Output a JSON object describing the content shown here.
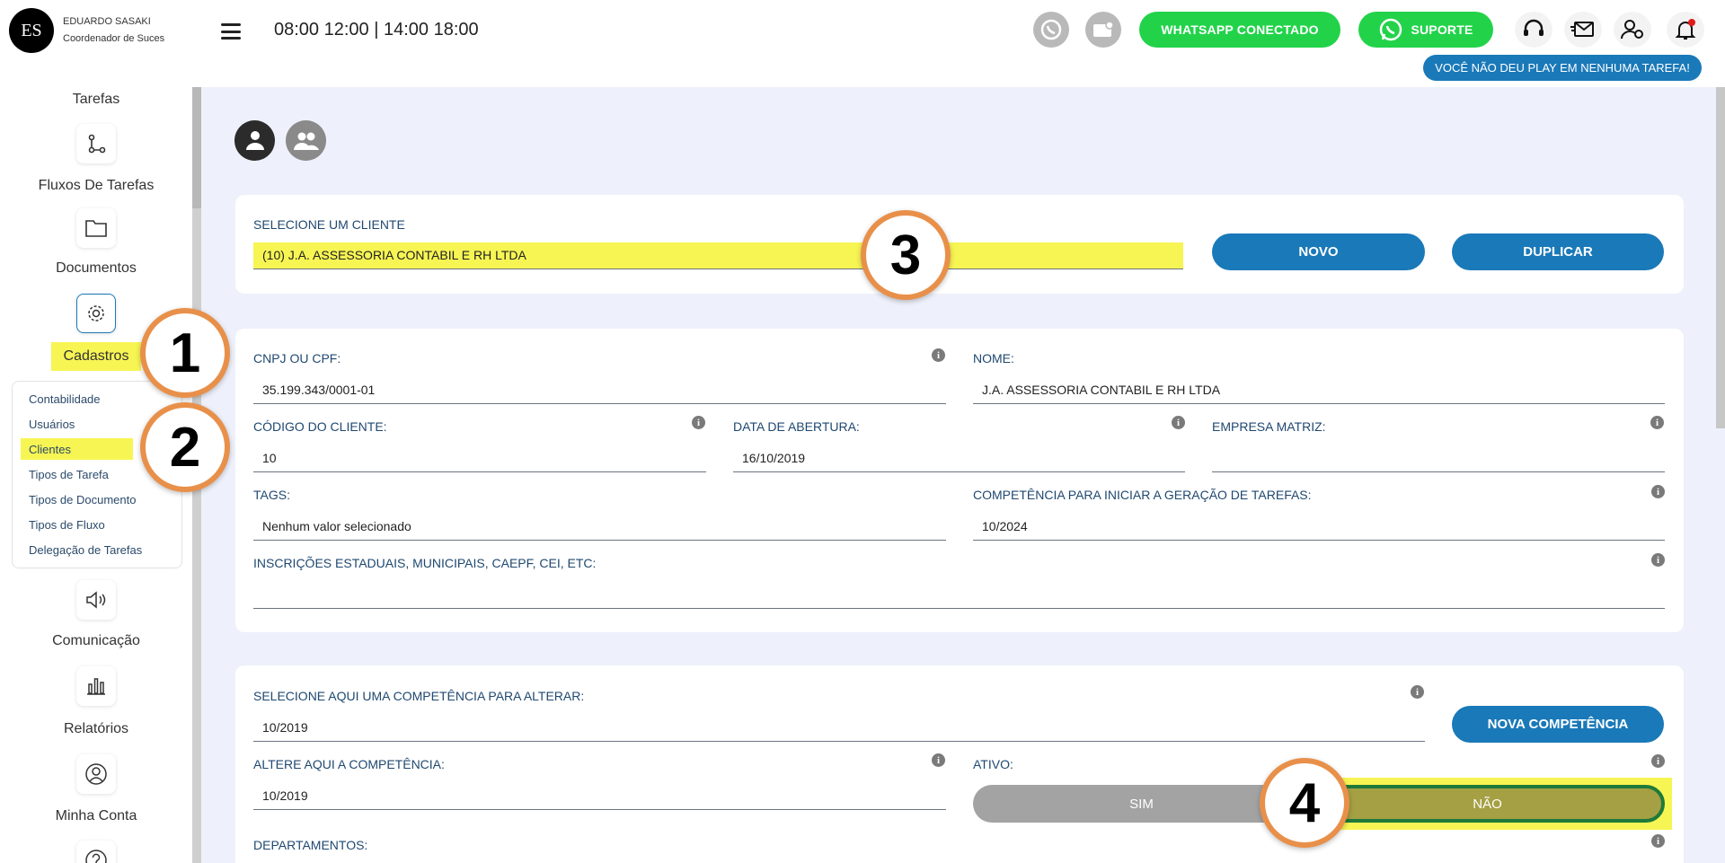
{
  "user": {
    "initials": "ES",
    "name": "EDUARDO SASAKI",
    "role": "Coordenador de Suces"
  },
  "header": {
    "hours": "08:00 12:00  |  14:00 18:00",
    "whatsapp_label": "WHATSAPP CONECTADO",
    "support_label": "SUPORTE",
    "notice": "VOCÊ NÃO DEU PLAY EM NENHUMA TAREFA!",
    "brand_green": "#22d34a",
    "accent_blue": "#1a79b8"
  },
  "sidebar": {
    "items": [
      {
        "label": "Tarefas"
      },
      {
        "label": "Fluxos De Tarefas",
        "icon": "flow-icon"
      },
      {
        "label": "Documentos",
        "icon": "folder-icon"
      },
      {
        "label": "Cadastros",
        "icon": "gear-icon"
      },
      {
        "label": "Comunicação",
        "icon": "speaker-icon"
      },
      {
        "label": "Relatórios",
        "icon": "bar-chart-icon"
      },
      {
        "label": "Minha Conta",
        "icon": "user-circle-icon"
      }
    ],
    "submenu": [
      {
        "label": "Contabilidade"
      },
      {
        "label": "Usuários"
      },
      {
        "label": "Clientes"
      },
      {
        "label": "Tipos de Tarefa"
      },
      {
        "label": "Tipos de Documento"
      },
      {
        "label": "Tipos de Fluxo"
      },
      {
        "label": "Delegação de Tarefas"
      }
    ]
  },
  "client_select": {
    "label": "SELECIONE UM CLIENTE",
    "value": "(10) J.A. ASSESSORIA CONTABIL E RH LTDA",
    "new_label": "NOVO",
    "duplicate_label": "DUPLICAR"
  },
  "client_form": {
    "cnpj_label": "CNPJ OU CPF:",
    "cnpj_value": "35.199.343/0001-01",
    "name_label": "NOME:",
    "name_value": "J.A. ASSESSORIA CONTABIL E RH LTDA",
    "code_label": "CÓDIGO DO CLIENTE:",
    "code_value": "10",
    "opening_label": "DATA DE ABERTURA:",
    "opening_value": "16/10/2019",
    "parent_label": "EMPRESA MATRIZ:",
    "parent_value": "",
    "tags_label": "TAGS:",
    "tags_value": "Nenhum valor selecionado",
    "competence_start_label": "COMPETÊNCIA PARA INICIAR A GERAÇÃO DE TAREFAS:",
    "competence_start_value": "10/2024",
    "registrations_label": "INSCRIÇÕES ESTADUAIS, MUNICIPAIS, CAEPF, CEI, ETC:",
    "registrations_value": ""
  },
  "competence_form": {
    "select_label": "SELECIONE AQUI UMA COMPETÊNCIA PARA ALTERAR:",
    "select_value": "10/2019",
    "new_competence_label": "NOVA COMPETÊNCIA",
    "alter_label": "ALTERE AQUI A COMPETÊNCIA:",
    "alter_value": "10/2019",
    "active_label": "ATIVO:",
    "yes_label": "SIM",
    "no_label": "NÃO",
    "departments_label": "DEPARTAMENTOS:"
  },
  "callouts": {
    "one": "1",
    "two": "2",
    "three": "3",
    "four": "4"
  },
  "info_glyph": "i"
}
